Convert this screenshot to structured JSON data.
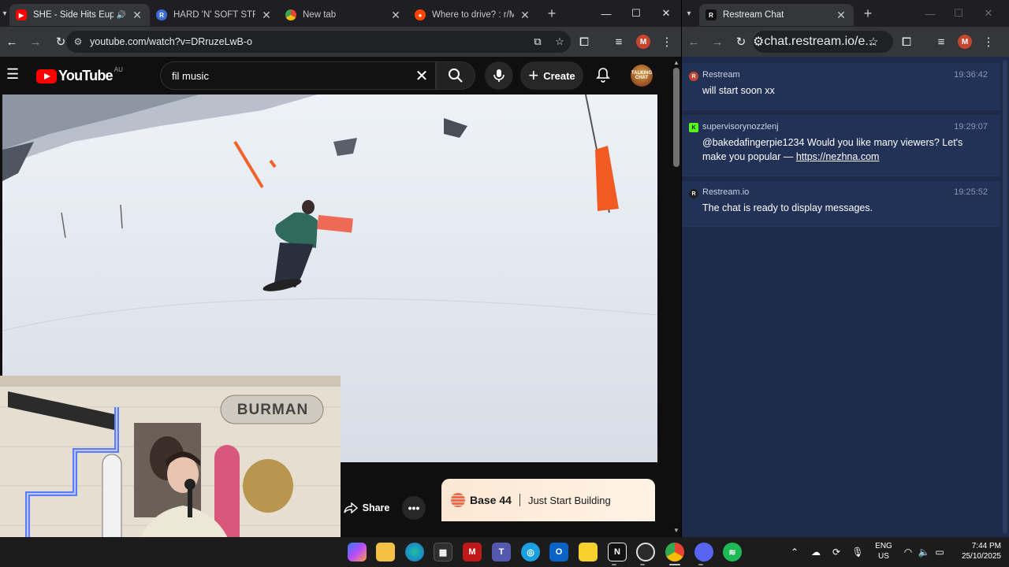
{
  "left_browser": {
    "tabs": [
      {
        "title": "SHE - Side Hits Euph",
        "favicon": "youtube-icon",
        "active": true,
        "audio": true
      },
      {
        "title": "HARD 'N' SOFT STREAM",
        "favicon": "R"
      },
      {
        "title": "New tab",
        "favicon": "chrome-icon"
      },
      {
        "title": "Where to drive? : r/Mac",
        "favicon": "reddit-icon"
      }
    ],
    "url": "youtube.com/watch?v=DRruzeLwB-o",
    "profile_initial": "M"
  },
  "youtube": {
    "logo_text": "YouTube",
    "country_code": "AU",
    "search_value": "fil music",
    "create_label": "Create",
    "channel_avatar_text": "TALKING CHAT",
    "share_label": "Share"
  },
  "ad": {
    "brand": "Base 44",
    "tagline": "Just Start Building"
  },
  "webcam": {
    "sign_text": "BURMAN"
  },
  "right_browser": {
    "tab_title": "Restream Chat",
    "tab_favicon": "R",
    "url": "chat.restream.io/e...",
    "profile_initial": "M"
  },
  "chat": {
    "messages": [
      {
        "source": "Restream",
        "source_icon": "R",
        "source_color": "#c5462f",
        "user": "Restream",
        "time": "19:36:42",
        "text": "will start soon xx"
      },
      {
        "source": "Kick",
        "source_icon": "K",
        "source_color": "#53fc18",
        "user": "supervisorynozzlenj",
        "time": "19:29:07",
        "text_prefix": "@bakedafingerpie1234 Would you like many viewers? Let's make you popular — ",
        "link": "https://nezhna.com"
      },
      {
        "source": "Restream",
        "source_icon": "R",
        "source_color": "#1f1f1f",
        "user": "Restream.io",
        "time": "19:25:52",
        "text": "The chat is ready to display messages."
      }
    ]
  },
  "taskbar": {
    "apps": [
      "copilot-icon",
      "file-explorer-icon",
      "edge-icon",
      "store-icon",
      "mcafee-icon",
      "teams-icon",
      "globe-icon",
      "outlook-icon",
      "sticky-notes-icon",
      "notion-icon",
      "obs-icon",
      "chrome-icon",
      "discord-icon",
      "spotify-icon"
    ],
    "lang_line1": "ENG",
    "lang_line2": "US",
    "time": "7:44 PM",
    "date": "25/10/2025"
  },
  "colors": {
    "youtube_red": "#ff0000",
    "chat_bg": "#1d2a49",
    "chat_msg_bg": "#223156",
    "browser_toolbar": "#35363a",
    "taskbar": "#1c1c1c"
  }
}
